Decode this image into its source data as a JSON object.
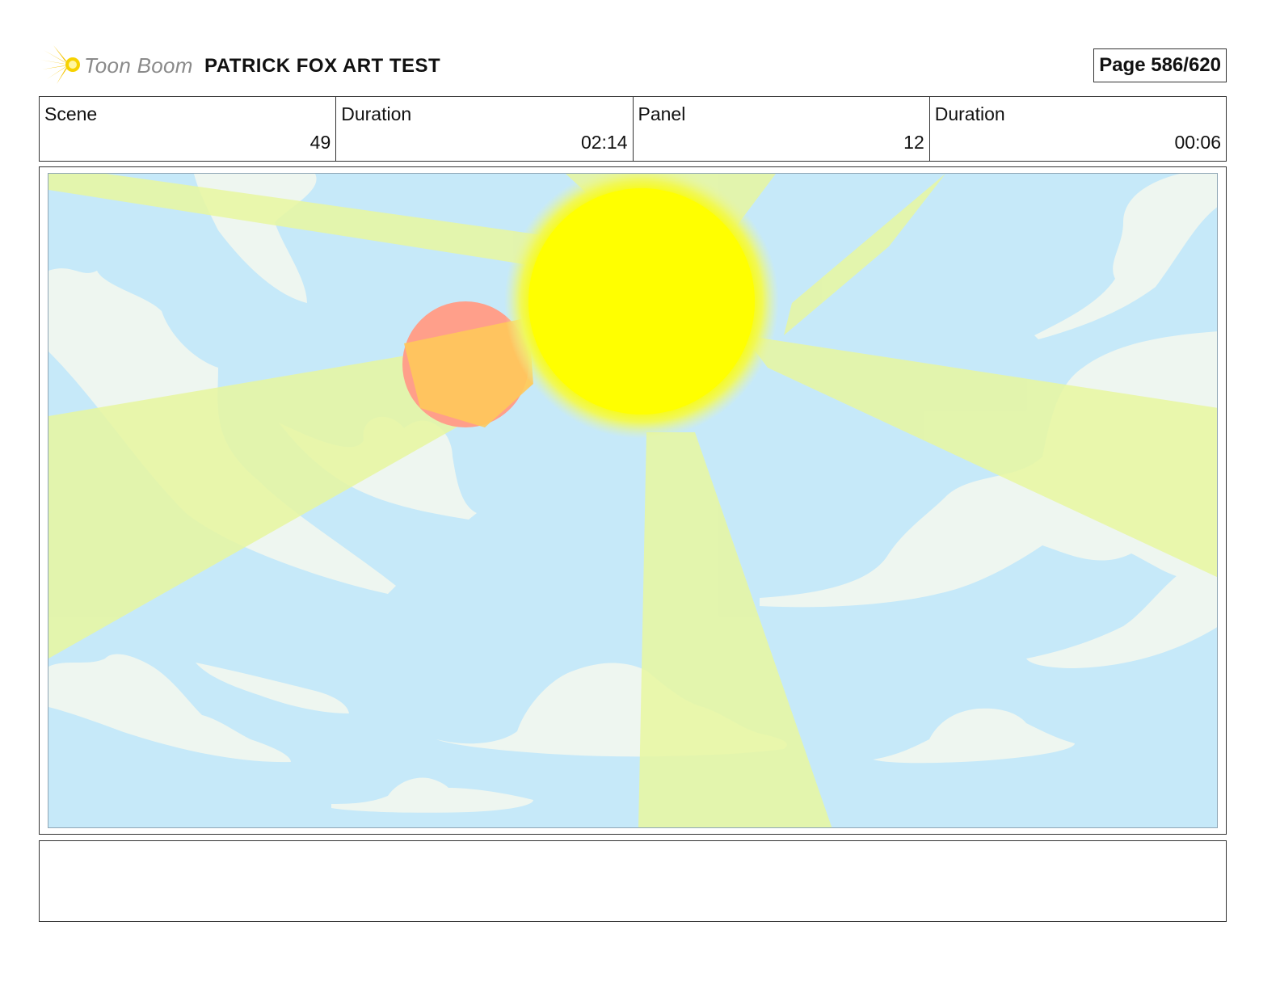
{
  "header": {
    "logo_text": "Toon Boom",
    "project_title": "PATRICK FOX ART TEST",
    "page_label": "Page 586/620"
  },
  "info": {
    "scene_label": "Scene",
    "scene_value": "49",
    "scene_duration_label": "Duration",
    "scene_duration_value": "02:14",
    "panel_label": "Panel",
    "panel_value": "12",
    "panel_duration_label": "Duration",
    "panel_duration_value": "00:06"
  },
  "notes": {
    "text": ""
  },
  "colors": {
    "sky": "#c6e9f9",
    "sun": "#ffff00",
    "sun_glow": "#eef75a",
    "planet": "#ff9f8a",
    "cloud": "#eef6f0",
    "sun_rays": "#e8f7a0"
  }
}
